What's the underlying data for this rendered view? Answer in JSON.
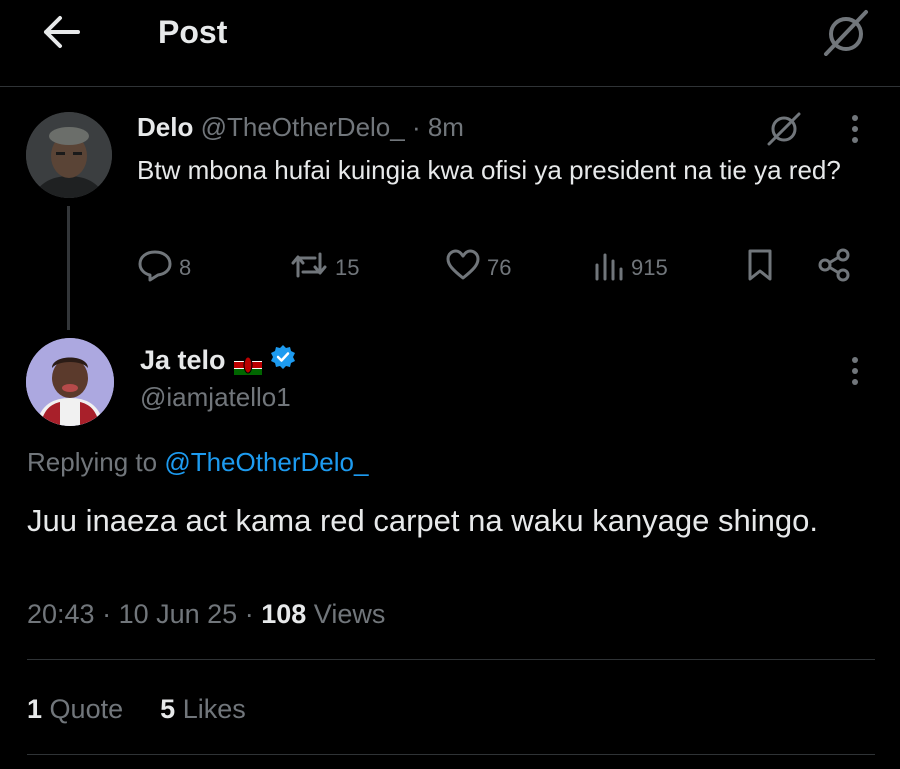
{
  "header": {
    "title": "Post"
  },
  "parent_post": {
    "name": "Delo",
    "handle": "@TheOtherDelo_",
    "time": "· 8m",
    "text": "Btw mbona hufai kuingia kwa ofisi ya president na tie ya red?",
    "replies": "8",
    "reposts": "15",
    "likes": "76",
    "views": "915"
  },
  "reply_post": {
    "name": "Ja telo",
    "handle": "@iamjatello1",
    "replying_prefix": "Replying to ",
    "replying_to": "@TheOtherDelo_",
    "text": "Juu inaeza act kama red carpet na waku kanyage shingo.",
    "time": "20:43",
    "date": "10 Jun 25",
    "views_count": "108",
    "views_label": "Views",
    "quotes_count": "1",
    "quotes_label": "Quote",
    "likes_count": "5",
    "likes_label": "Likes"
  },
  "colors": {
    "background": "#000000",
    "text": "#e7e9ea",
    "muted": "#71767b",
    "accent": "#1d9bf0",
    "verified": "#1d9bf0"
  },
  "icons": [
    "back-arrow-icon",
    "grok-icon",
    "more-icon",
    "reply-icon",
    "repost-icon",
    "like-icon",
    "views-icon",
    "bookmark-icon",
    "share-icon",
    "kenya-flag-icon",
    "verified-icon"
  ]
}
